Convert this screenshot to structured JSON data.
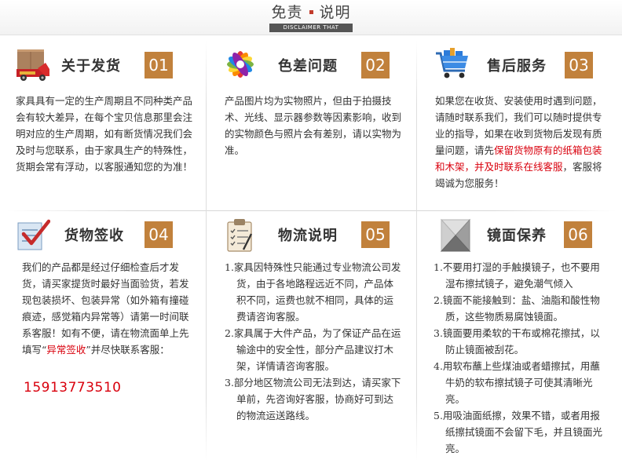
{
  "header": {
    "title_left": "免责",
    "title_right": "说明",
    "subtitle": "DISCLAIMER THAT"
  },
  "colors": {
    "accent": "#c1813c",
    "highlight": "#d9000d"
  },
  "panels": [
    {
      "title": "关于发货",
      "number": "01",
      "icon": "delivery-truck-icon",
      "text": "家具具有一定的生产周期且不同种类产品会有较大差异，在每个宝贝信息那里会注明对应的生产周期，如有断货情况我们会及时与您联系，由于家具生产的特殊性，货期会常有浮动，以客服通知您的为准！"
    },
    {
      "title": "色差问题",
      "number": "02",
      "icon": "color-palette-icon",
      "text": "产品图片均为实物照片，但由于拍摄技术、光线、显示器参数等因素影响，收到的实物颜色与照片会有差别，请以实物为准。"
    },
    {
      "title": "售后服务",
      "number": "03",
      "icon": "shopping-cart-icon",
      "text_a": "如果您在收货、安装使用时遇到问题，请随时联系我们，我们可以随时提供专业的指导，如果在收到货物后发现有质量问题，请先",
      "text_hl": "保留货物原有的纸箱包装和木架，并及时联系在线客服",
      "text_b": "，客服将竭诚为您服务！"
    },
    {
      "title": "货物签收",
      "number": "04",
      "icon": "checklist-icon",
      "text_a": "我们的产品都是经过仔细检查后才发货，请买家提货时最好当面验货，若发现包装损坏、包装异常（如外箱有撞碰痕迹，感觉箱内异常等）请第一时间联系客服！如有不便，请在物流面单上先填写“",
      "text_hl": "异常签收",
      "text_b": "”并尽快联系客服：",
      "phone": "15913773510"
    },
    {
      "title": "物流说明",
      "number": "05",
      "icon": "clipboard-icon",
      "items": [
        "1.家具因特殊性只能通过专业物流公司发货，由于各地路程远近不同，产品体积不同，运费也就不相同，具体的运费请咨询客服。",
        "2.家具属于大件产品，为了保证产品在运输途中的安全性，部分产品建议打木架，详情请咨询客服。",
        "3.部分地区物流公司无法到达，请买家下单前，先咨询好客服，协商好可到达的物流运送路线。"
      ]
    },
    {
      "title": "镜面保养",
      "number": "06",
      "icon": "crystal-prism-icon",
      "items": [
        "1.不要用打湿的手触摸镜子，也不要用湿布擦拭镜子，避免潮气倾入",
        "2.镜面不能接触到：盐、油脂和酸性物质，这些物质易腐蚀镜面。",
        "3.镜面要用柔软的干布或棉花擦拭，以防止镜面被刮花。",
        "4.用软布蘸上些煤油或者蜡擦拭，用蘸牛奶的软布擦拭镜子可使其清晰光亮。",
        "5.用吸油面纸擦，效果不错，或者用报纸擦拭镜面不会留下毛，并且镜面光亮。"
      ]
    }
  ]
}
